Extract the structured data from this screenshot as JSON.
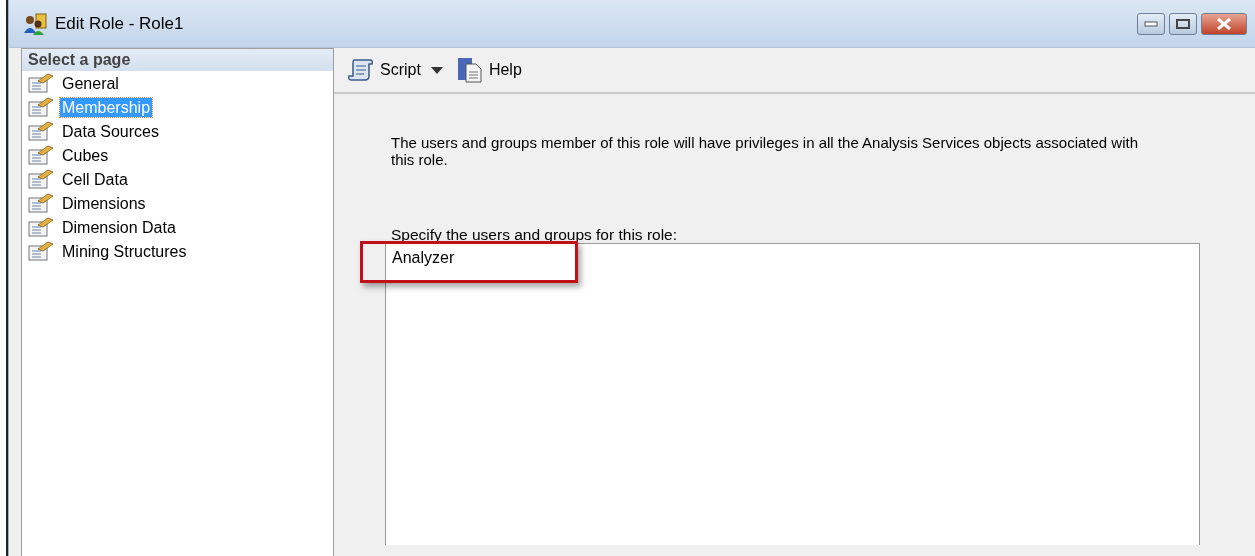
{
  "window": {
    "title": "Edit Role - Role1",
    "controls": [
      {
        "kind": "minimize"
      },
      {
        "kind": "maximize"
      },
      {
        "kind": "close"
      }
    ]
  },
  "sidebar": {
    "header": "Select a page",
    "items": [
      {
        "label": "General",
        "selected": false
      },
      {
        "label": "Membership",
        "selected": true
      },
      {
        "label": "Data Sources",
        "selected": false
      },
      {
        "label": "Cubes",
        "selected": false
      },
      {
        "label": "Cell Data",
        "selected": false
      },
      {
        "label": "Dimensions",
        "selected": false
      },
      {
        "label": "Dimension Data",
        "selected": false
      },
      {
        "label": "Mining Structures",
        "selected": false
      }
    ]
  },
  "toolbar": [
    {
      "kind": "script",
      "label": "Script",
      "dropdown": true
    },
    {
      "kind": "help",
      "label": "Help",
      "dropdown": false
    }
  ],
  "description": "The users and groups member of this role will have privileges in all the Analysis Services objects associated with this role.",
  "members": {
    "label": "Specify the users and groups for this role:",
    "items": [
      {
        "name": "Analyzer",
        "highlighted": true
      }
    ]
  }
}
